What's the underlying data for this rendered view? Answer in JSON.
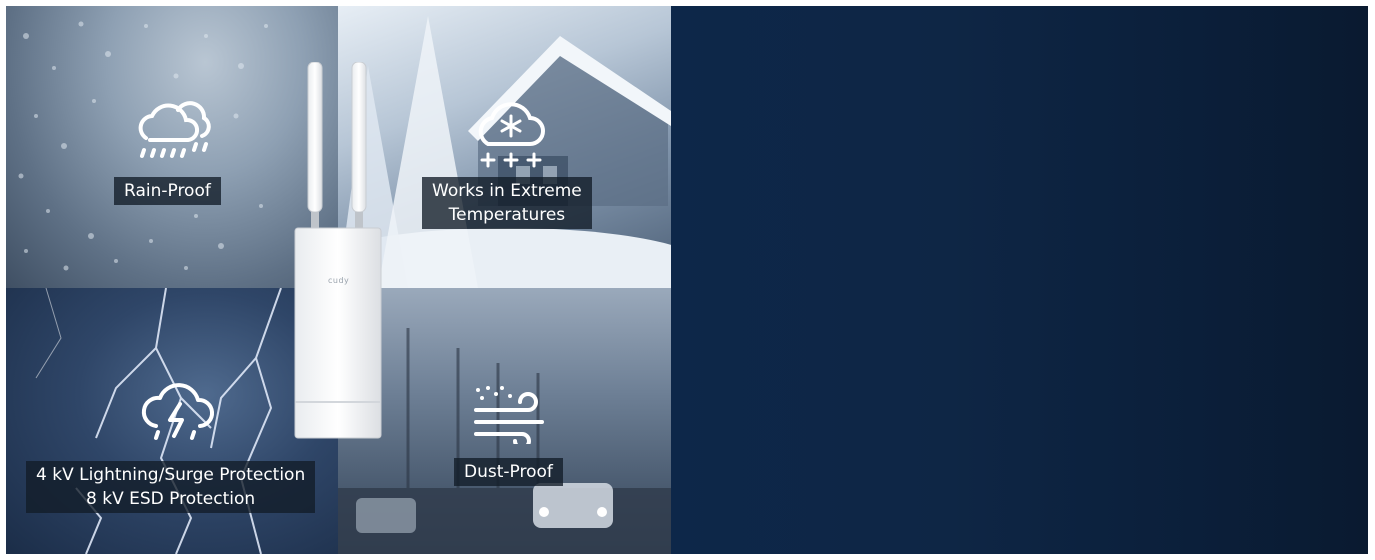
{
  "features": {
    "rain": {
      "label": "Rain-Proof",
      "icon": "rain-cloud-icon"
    },
    "temperature": {
      "line1": "Works in Extreme",
      "line2": "Temperatures",
      "icon": "snow-cloud-icon"
    },
    "lightning": {
      "line1": "4 kV Lightning/Surge Protection",
      "line2": "8 kV ESD Protection",
      "icon": "lightning-cloud-icon"
    },
    "dust": {
      "label": "Dust-Proof",
      "icon": "wind-dust-icon"
    }
  },
  "device": {
    "brand": "cudy"
  },
  "colors": {
    "right_panel": "#0e2645",
    "label_bg": "#121c28",
    "icon": "#ffffff"
  }
}
